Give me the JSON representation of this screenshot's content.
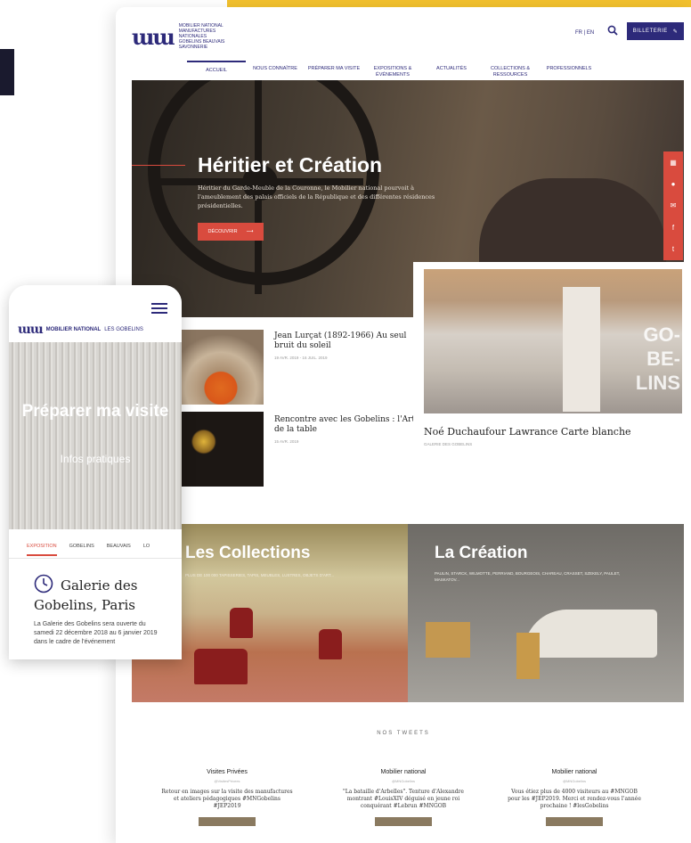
{
  "desktop": {
    "logo": {
      "mark": "ɯɯ",
      "text_lines": [
        "MOBILIER NATIONAL",
        "MANUFACTURES NATIONALES",
        "GOBELINS BEAUVAIS",
        "SAVONNERIE"
      ]
    },
    "lang": "FR | EN",
    "ticket_label": "BILLETERIE",
    "nav": [
      {
        "label": "ACCUEIL",
        "active": true
      },
      {
        "label": "NOUS CONNAÎTRE"
      },
      {
        "label": "PRÉPARER MA VISITE"
      },
      {
        "label": "EXPOSITIONS & ÉVÉNEMENTS"
      },
      {
        "label": "ACTUALITÉS"
      },
      {
        "label": "COLLECTIONS & RESSOURCES"
      },
      {
        "label": "PROFESSIONNELS"
      }
    ],
    "hero": {
      "title": "Héritier et Création",
      "description": "Héritier du Garde-Meuble de la Couronne, le Mobilier national pourvoit à l'ameublement des palais officiels de la République et des différentes résidences présidentielles.",
      "button_label": "DÉCOUVRIR"
    },
    "news": [
      {
        "title": "Jean Lurçat (1892-1966) Au seul bruit du soleil",
        "date": "19 AVR. 2019 - 16 JUIL. 2019"
      },
      {
        "title": "Rencontre avec les Gobelins : l'Art de la table",
        "date": "15 AVR. 2019"
      }
    ],
    "gobelins": {
      "word_lines": [
        "GO-",
        "BE-",
        "LINS"
      ],
      "title": "Noé Duchaufour Lawrance Carte blanche",
      "subtitle": "GALERIE DES GOBELINS"
    },
    "collections": {
      "title": "Les Collections",
      "subtitle": "PLUS DE 100 000 TAPISSERIES, TAPIS, MEUBLES, LUSTRES, OBJETS D'ART..."
    },
    "creation": {
      "title": "La Création",
      "subtitle": "PAULIN, STARCK, WILMOTTE, PERRIAND, BOURGEOIS, CHAREAU, CRASSET, SZEKELY, PAULET, MASKATOV..."
    },
    "tweets_heading": "NOS TWEETS",
    "tweets": [
      {
        "name": "Visites Privées",
        "handle": "@VisitesPrivees",
        "text": "Retour en images sur la visite des manufactures et ateliers pédagogiques #MNGobelins #JEP2019"
      },
      {
        "name": "Mobilier national",
        "handle": "@MNGobelins",
        "text": "\"La bataille d'Arbelles\". Tenture d'Alexandre montrant #LouisXIV déguisé en jeune roi conquérant #Lebrun #MNGOB"
      },
      {
        "name": "Mobilier national",
        "handle": "@MNGobelins",
        "text": "Vous étiez plus de 4000 visiteurs au #MNGOB pour les #JEP2019. Merci et rendez-vous l'année prochaine ! #lesGobelins"
      }
    ]
  },
  "mobile": {
    "logo_mark": "ɯɯ",
    "brand": "MOBILIER NATIONAL",
    "brand_sub": "LES GOBELINS",
    "hero_title": "Préparer ma visite",
    "hero_subtitle": "Infos pratiques",
    "tabs": [
      {
        "label": "EXPOSITION",
        "active": true
      },
      {
        "label": "GOBELINS"
      },
      {
        "label": "BEAUVAIS"
      },
      {
        "label": "LO"
      }
    ],
    "card_title": "Galerie des Gobelins, Paris",
    "card_desc": "La Galerie des Gobelins sera ouverte du samedi 22 décembre 2018 au 6 janvier 2019 dans le cadre de l'événement"
  },
  "colors": {
    "brand_navy": "#2d2a7a",
    "accent_red": "#d94b3e",
    "accent_yellow": "#f2c12e"
  },
  "icons": [
    "search-icon",
    "ticket-icon",
    "arrow-right-icon",
    "calendar-icon",
    "info-icon",
    "mail-icon",
    "facebook-icon",
    "twitter-icon",
    "hamburger-icon",
    "clock-icon"
  ]
}
